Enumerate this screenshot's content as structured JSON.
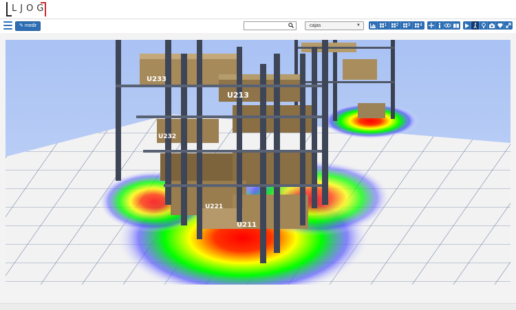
{
  "header": {
    "logo_text": "LJOG",
    "brand_color": "#c9262c"
  },
  "toolbar": {
    "medir_label": "medir",
    "search": {
      "value": "",
      "placeholder": ""
    },
    "layer_select": {
      "selected": "cajas"
    },
    "view_buttons": [
      {
        "icon": "bar-chart-icon",
        "label": ""
      },
      {
        "icon": "grid-icon",
        "label": "1"
      },
      {
        "icon": "grid-icon",
        "label": "2"
      },
      {
        "icon": "grid-icon",
        "label": "3"
      },
      {
        "icon": "grid-icon",
        "label": "4"
      }
    ],
    "tool_buttons": [
      "move-icon",
      "person-icon",
      "link-icon",
      "book-icon"
    ],
    "action_buttons": [
      "play-icon",
      "walker-icon",
      "bulb-icon",
      "camera-icon",
      "diamond-icon",
      "expand-icon"
    ],
    "accent_color": "#2d6db3"
  },
  "scene": {
    "rack_labels": [
      "U233",
      "U213",
      "U232",
      "U221",
      "U211"
    ],
    "heatmap_colors": [
      "#ff0000",
      "#ffff00",
      "#00ff00",
      "#5555ff"
    ]
  }
}
